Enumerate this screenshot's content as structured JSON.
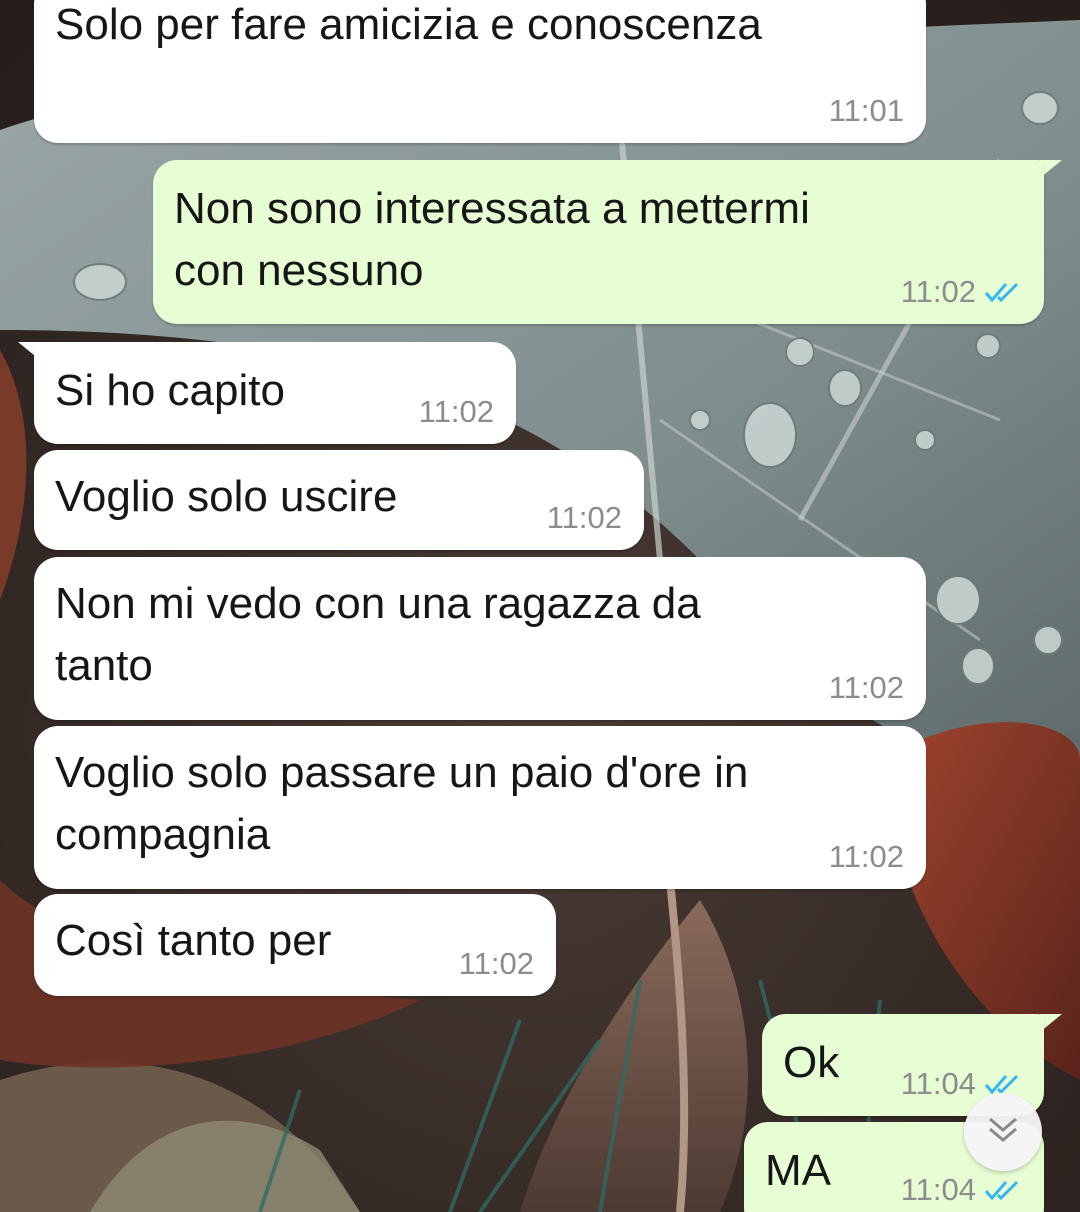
{
  "colors": {
    "incoming_bubble": "#ffffff",
    "outgoing_bubble": "#e7fdd3",
    "read_ticks": "#34b7f1",
    "timestamp": "#8c8c8c"
  },
  "messages": [
    {
      "direction": "incoming",
      "text": "Solo per fare amicizia e conoscenza",
      "time": "11:01"
    },
    {
      "direction": "outgoing",
      "text": "Non sono interessata a mettermi\ncon nessuno",
      "time": "11:02",
      "status_icon": "double-check-read-icon"
    },
    {
      "direction": "incoming",
      "text": "Si ho capito",
      "time": "11:02"
    },
    {
      "direction": "incoming",
      "text": "Voglio solo uscire",
      "time": "11:02"
    },
    {
      "direction": "incoming",
      "text": "Non mi vedo con una ragazza da\ntanto",
      "time": "11:02"
    },
    {
      "direction": "incoming",
      "text": "Voglio solo passare un paio d'ore in\ncompagnia",
      "time": "11:02"
    },
    {
      "direction": "incoming",
      "text": "Così tanto per",
      "time": "11:02"
    },
    {
      "direction": "outgoing",
      "text": "Ok",
      "time": "11:04",
      "status_icon": "double-check-read-icon"
    },
    {
      "direction": "outgoing",
      "text": "MA",
      "time": "11:04",
      "status_icon": "double-check-read-icon"
    }
  ],
  "scroll_button": {
    "icon": "double-chevron-down-icon"
  }
}
